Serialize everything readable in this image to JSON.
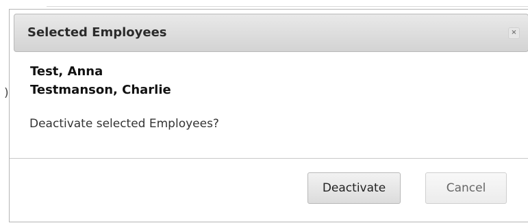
{
  "dialog": {
    "title": "Selected Employees",
    "close_glyph": "×",
    "close_icon": "close-icon",
    "employees": [
      "Test, Anna",
      "Testmanson, Charlie"
    ],
    "question": "Deactivate selected Employees?",
    "buttons": {
      "deactivate": "Deactivate",
      "cancel": "Cancel"
    }
  },
  "background": {
    "paren": ")"
  }
}
